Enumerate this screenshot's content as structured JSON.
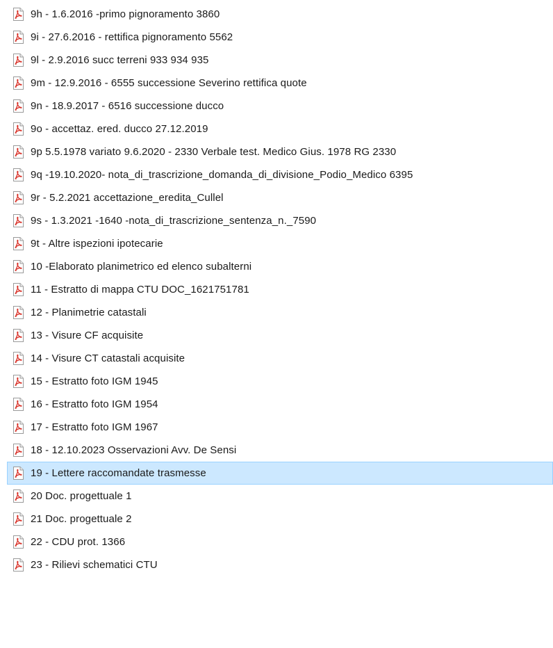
{
  "icon": "pdf-file-icon",
  "selected_index": 20,
  "files": [
    {
      "name": "9h - 1.6.2016 -primo pignoramento 3860"
    },
    {
      "name": "9i - 27.6.2016 - rettifica pignoramento 5562"
    },
    {
      "name": "9l - 2.9.2016 succ terreni 933 934 935"
    },
    {
      "name": "9m - 12.9.2016 - 6555 successione Severino rettifica quote"
    },
    {
      "name": "9n - 18.9.2017 - 6516 successione ducco"
    },
    {
      "name": "9o - accettaz. ered. ducco 27.12.2019"
    },
    {
      "name": "9p  5.5.1978 variato 9.6.2020 - 2330 Verbale test. Medico Gius. 1978 RG 2330"
    },
    {
      "name": "9q -19.10.2020- nota_di_trascrizione_domanda_di_divisione_Podio_Medico 6395"
    },
    {
      "name": "9r - 5.2.2021 accettazione_eredita_Cullel"
    },
    {
      "name": "9s - 1.3.2021 -1640 -nota_di_trascrizione_sentenza_n._7590"
    },
    {
      "name": "9t - Altre ispezioni ipotecarie"
    },
    {
      "name": "10 -Elaborato planimetrico ed elenco subalterni"
    },
    {
      "name": "11 - Estratto di mappa CTU DOC_1621751781"
    },
    {
      "name": "12 - Planimetrie catastali"
    },
    {
      "name": "13 - Visure CF acquisite"
    },
    {
      "name": "14 - Visure CT catastali acquisite"
    },
    {
      "name": "15 - Estratto foto IGM 1945"
    },
    {
      "name": "16 - Estratto foto IGM 1954"
    },
    {
      "name": "17 - Estratto foto IGM 1967"
    },
    {
      "name": "18 - 12.10.2023 Osservazioni Avv. De Sensi"
    },
    {
      "name": "19 - Lettere raccomandate trasmesse"
    },
    {
      "name": "20 Doc. progettuale 1"
    },
    {
      "name": "21 Doc. progettuale 2"
    },
    {
      "name": "22 - CDU prot. 1366"
    },
    {
      "name": "23 - Rilievi schematici CTU"
    }
  ],
  "colors": {
    "selection_bg": "#cce8ff",
    "selection_border": "#99d1ff",
    "pdf_red": "#d9342b"
  }
}
